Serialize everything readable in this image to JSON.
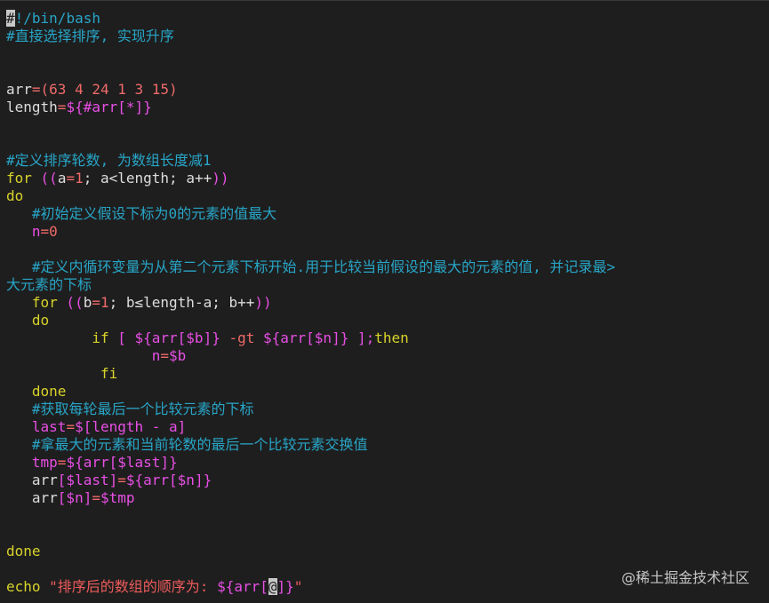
{
  "colors": {
    "background": "#1e1e1e",
    "plain": "#dddddd",
    "comment": "#28a5c7",
    "keyword": "#d8d32a",
    "variable": "#e84fe5",
    "number": "#f06a6a",
    "string": "#ef5b5b",
    "operator": "#f06a6a"
  },
  "code_lines": [
    [
      {
        "t": "#",
        "c": "cursor"
      },
      {
        "t": "!/bin/bash",
        "c": "comment"
      }
    ],
    [
      {
        "t": "#直接选择排序, 实现升序",
        "c": "comment"
      }
    ],
    [],
    [],
    [
      {
        "t": "arr",
        "c": "plain"
      },
      {
        "t": "=(63 4 24 1 3 15)",
        "c": "number"
      }
    ],
    [
      {
        "t": "length",
        "c": "plain"
      },
      {
        "t": "=",
        "c": "number"
      },
      {
        "t": "${#arr[*]}",
        "c": "variable"
      }
    ],
    [],
    [],
    [
      {
        "t": "#定义排序轮数, 为数组长度减1",
        "c": "comment"
      }
    ],
    [
      {
        "t": "for",
        "c": "keyword"
      },
      {
        "t": " ((",
        "c": "variable"
      },
      {
        "t": "a",
        "c": "plain"
      },
      {
        "t": "=1",
        "c": "number"
      },
      {
        "t": "; a<length; a++",
        "c": "plain"
      },
      {
        "t": "))",
        "c": "variable"
      }
    ],
    [
      {
        "t": "do",
        "c": "keyword"
      }
    ],
    [
      {
        "t": "   #初始定义假设下标为0的元素的值最大",
        "c": "comment"
      }
    ],
    [
      {
        "t": "   n",
        "c": "variable"
      },
      {
        "t": "=0",
        "c": "number"
      }
    ],
    [],
    [
      {
        "t": "   #定义内循环变量为从第二个元素下标开始.用于比较当前假设的最大的元素的值, 并记录最>",
        "c": "comment"
      }
    ],
    [
      {
        "t": "大元素的下标",
        "c": "comment"
      }
    ],
    [
      {
        "t": "   for",
        "c": "keyword"
      },
      {
        "t": " ((",
        "c": "variable"
      },
      {
        "t": "b",
        "c": "plain"
      },
      {
        "t": "=1",
        "c": "number"
      },
      {
        "t": "; b≤length-a; b++",
        "c": "plain"
      },
      {
        "t": "))",
        "c": "variable"
      }
    ],
    [
      {
        "t": "   do",
        "c": "keyword"
      }
    ],
    [
      {
        "t": "          if",
        "c": "keyword"
      },
      {
        "t": " [ ",
        "c": "variable"
      },
      {
        "t": "${arr[$b]}",
        "c": "variable"
      },
      {
        "t": " -gt ",
        "c": "number"
      },
      {
        "t": "${arr[$n]}",
        "c": "variable"
      },
      {
        "t": " ];",
        "c": "variable"
      },
      {
        "t": "then",
        "c": "keyword"
      }
    ],
    [
      {
        "t": "                 n",
        "c": "variable"
      },
      {
        "t": "=",
        "c": "number"
      },
      {
        "t": "$b",
        "c": "variable"
      }
    ],
    [
      {
        "t": "           fi",
        "c": "keyword"
      }
    ],
    [
      {
        "t": "   done",
        "c": "keyword"
      }
    ],
    [
      {
        "t": "   #获取每轮最后一个比较元素的下标",
        "c": "comment"
      }
    ],
    [
      {
        "t": "   last",
        "c": "variable"
      },
      {
        "t": "=",
        "c": "number"
      },
      {
        "t": "$[length - a]",
        "c": "variable"
      }
    ],
    [
      {
        "t": "   #拿最大的元素和当前轮数的最后一个比较元素交换值",
        "c": "comment"
      }
    ],
    [
      {
        "t": "   tmp",
        "c": "variable"
      },
      {
        "t": "=",
        "c": "number"
      },
      {
        "t": "${arr[$last]}",
        "c": "variable"
      }
    ],
    [
      {
        "t": "   arr",
        "c": "plain"
      },
      {
        "t": "[$last]",
        "c": "variable"
      },
      {
        "t": "=",
        "c": "number"
      },
      {
        "t": "${arr[$n]}",
        "c": "variable"
      }
    ],
    [
      {
        "t": "   arr",
        "c": "plain"
      },
      {
        "t": "[$n]",
        "c": "variable"
      },
      {
        "t": "=",
        "c": "number"
      },
      {
        "t": "$tmp",
        "c": "variable"
      }
    ],
    [],
    [],
    [
      {
        "t": "done",
        "c": "keyword"
      }
    ],
    [],
    [
      {
        "t": "echo",
        "c": "keyword"
      },
      {
        "t": " \"排序后的数组的顺序为: ",
        "c": "string"
      },
      {
        "t": "${arr[",
        "c": "variable"
      },
      {
        "t": "@",
        "c": "cursor"
      },
      {
        "t": "]}",
        "c": "variable"
      },
      {
        "t": "\"",
        "c": "string"
      }
    ]
  ],
  "watermark": "@稀土掘金技术社区"
}
